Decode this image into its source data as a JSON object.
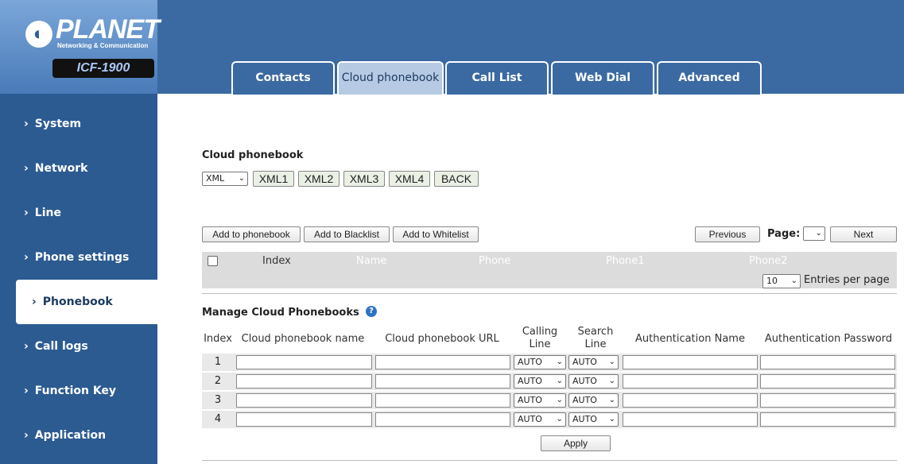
{
  "brand": {
    "logo_text": "PLANET",
    "tagline": "Networking & Communication",
    "model": "ICF-1900"
  },
  "tabs": [
    {
      "label": "Contacts"
    },
    {
      "label": "Cloud phonebook"
    },
    {
      "label": "Call List"
    },
    {
      "label": "Web Dial"
    },
    {
      "label": "Advanced"
    }
  ],
  "sidebar": {
    "items": [
      {
        "label": "System"
      },
      {
        "label": "Network"
      },
      {
        "label": "Line"
      },
      {
        "label": "Phone settings"
      },
      {
        "label": "Phonebook"
      },
      {
        "label": "Call logs"
      },
      {
        "label": "Function Key"
      },
      {
        "label": "Application"
      }
    ]
  },
  "cloud": {
    "title": "Cloud phonebook",
    "type_select": "XML",
    "xml_buttons": [
      "XML1",
      "XML2",
      "XML3",
      "XML4",
      "BACK"
    ]
  },
  "actions": {
    "add_phonebook": "Add to phonebook",
    "add_blacklist": "Add to Blacklist",
    "add_whitelist": "Add to Whitelist",
    "previous": "Previous",
    "page_label": "Page:",
    "next": "Next"
  },
  "contacts_table": {
    "columns": [
      "Index",
      "Name",
      "Phone",
      "Phone1",
      "Phone2"
    ],
    "entries_value": "10",
    "entries_label": "Entries per page"
  },
  "manage": {
    "title": "Manage Cloud Phonebooks",
    "columns": [
      "Index",
      "Cloud phonebook name",
      "Cloud phonebook URL",
      "Calling Line",
      "Search Line",
      "Authentication Name",
      "Authentication Password"
    ],
    "rows": [
      {
        "index": "1",
        "calling": "AUTO",
        "search": "AUTO"
      },
      {
        "index": "2",
        "calling": "AUTO",
        "search": "AUTO"
      },
      {
        "index": "3",
        "calling": "AUTO",
        "search": "AUTO"
      },
      {
        "index": "4",
        "calling": "AUTO",
        "search": "AUTO"
      }
    ],
    "apply": "Apply"
  },
  "colors": {
    "header": "#3b6aa3",
    "sidebar": "#2c5b92",
    "active_tab": "#b6cbe3"
  }
}
